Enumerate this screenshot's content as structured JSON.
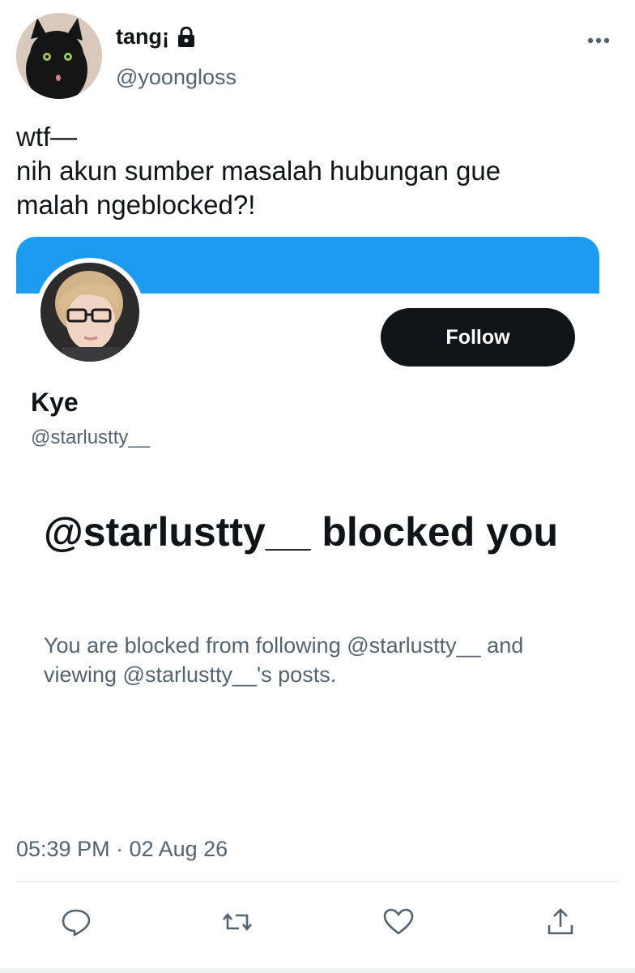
{
  "tweet": {
    "author_name": "tang¡",
    "author_handle": "@yoongloss",
    "text": "wtf—\nnih akun sumber masalah hubungan gue\nmalah ngeblocked?!",
    "timestamp": "05:39 PM · 02 Aug 26"
  },
  "embedded": {
    "profile_name": "Kye",
    "profile_handle": "@starlustty__",
    "follow_label": "Follow",
    "blocked_title": "@starlustty__ blocked you",
    "blocked_description": "You are blocked from following @starlustty__ and viewing @starlustty__'s posts.",
    "banner_color": "#1d9bf0"
  },
  "actions": {
    "reply_icon": "reply-icon",
    "retweet_icon": "retweet-icon",
    "like_icon": "heart-icon",
    "share_icon": "share-icon"
  },
  "colors": {
    "text_primary": "#0f1419",
    "text_secondary": "#536471",
    "accent": "#1d9bf0",
    "button_dark": "#0f1419"
  }
}
